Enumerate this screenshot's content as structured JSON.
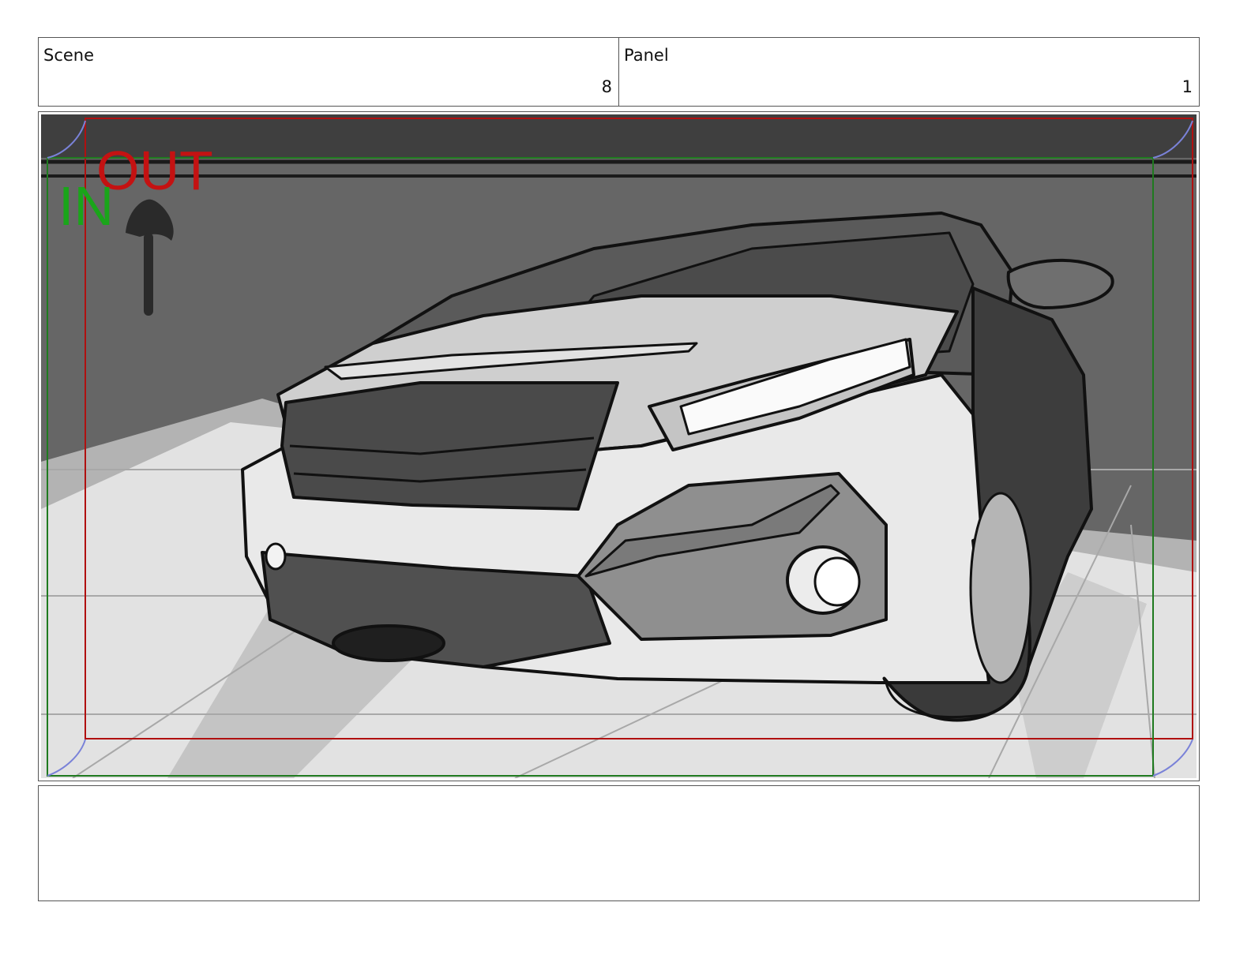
{
  "header": {
    "scene_label": "Scene",
    "scene_value": "8",
    "panel_label": "Panel",
    "panel_value": "1"
  },
  "panel": {
    "in_label": "IN",
    "out_label": "OUT",
    "colors": {
      "in_frame": "#1f7a1f",
      "out_frame": "#b01010",
      "in_text": "#1aa51a",
      "out_text": "#c41212"
    }
  },
  "notes": {
    "text": ""
  }
}
